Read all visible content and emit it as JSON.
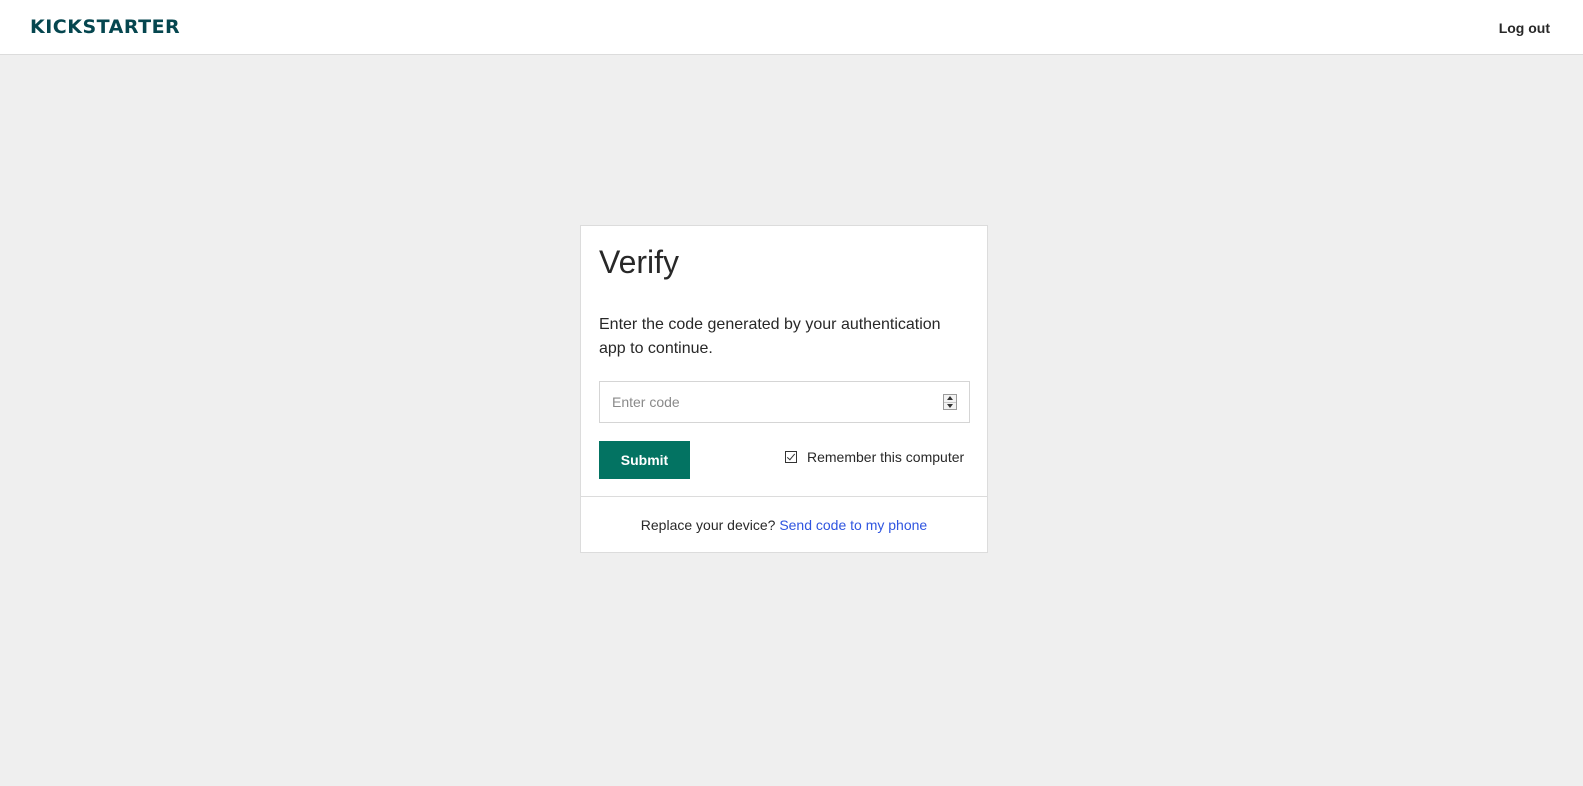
{
  "header": {
    "logo_text": "KICKSTARTER",
    "logout_label": "Log out"
  },
  "verify": {
    "title": "Verify",
    "instructions": "Enter the code generated by your authentication app to continue.",
    "code_placeholder": "Enter code",
    "code_value": "",
    "submit_label": "Submit",
    "remember_label": "Remember this computer",
    "remember_checked": true
  },
  "footer": {
    "prompt": "Replace your device?",
    "link_label": "Send code to my phone"
  },
  "colors": {
    "brand": "#05464f",
    "button": "#037362",
    "link": "#2f55e0",
    "background": "#efefef"
  }
}
